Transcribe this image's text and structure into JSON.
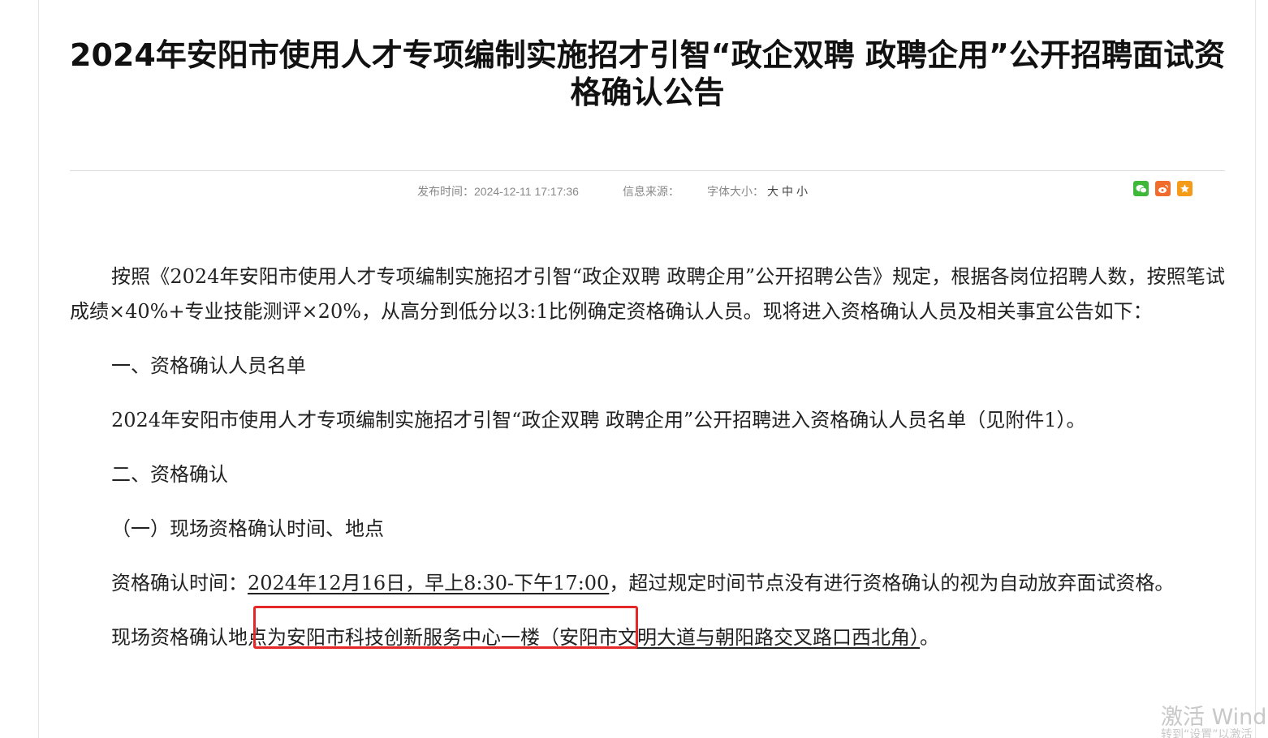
{
  "article": {
    "title": "2024年安阳市使用人才专项编制实施招才引智“政企双聘 政聘企用”公开招聘面试资格确认公告",
    "meta": {
      "publish_label": "发布时间：",
      "publish_time": "2024-12-11 17:17:36",
      "source_label": "信息来源：",
      "font_size_label": "字体大小：",
      "size_large": "大",
      "size_medium": "中",
      "size_small": "小"
    },
    "share": {
      "wechat_icon": "wechat-icon",
      "weibo_icon": "weibo-icon",
      "favorite_icon": "favorite-icon"
    },
    "paragraphs": {
      "intro": "按照《2024年安阳市使用人才专项编制实施招才引智“政企双聘 政聘企用”公开招聘公告》规定，根据各岗位招聘人数，按照笔试成绩×40%+专业技能测评×20%，从高分到低分以3:1比例确定资格确认人员。现将进入资格确认人员及相关事宜公告如下：",
      "section1_heading": "一、资格确认人员名单",
      "section1_text": "2024年安阳市使用人才专项编制实施招才引智“政企双聘 政聘企用”公开招聘进入资格确认人员名单（见附件1）。",
      "section2_heading": "二、资格确认",
      "subsection1_heading": "（一）现场资格确认时间、地点",
      "time_label": "资格确认时间：",
      "time_value": "2024年12月16日，早上8:30-下午17:00",
      "time_suffix": "，超过规定时间节点没有进行资格确认的视为自动放弃面试资格。",
      "location_prefix": "现场资格确认地点为",
      "location_value": "安阳市科技创新服务中心一楼（安阳市文明大道与朝阳路交叉路口西北角）",
      "location_suffix": "。"
    }
  },
  "watermark": {
    "main": "激活 Windo",
    "sub": "转到“设置”以激活"
  },
  "colors": {
    "highlight_border": "#e52727",
    "wechat": "#3fb83a",
    "weibo": "#f06b2c",
    "favorite": "#f59b1a"
  }
}
